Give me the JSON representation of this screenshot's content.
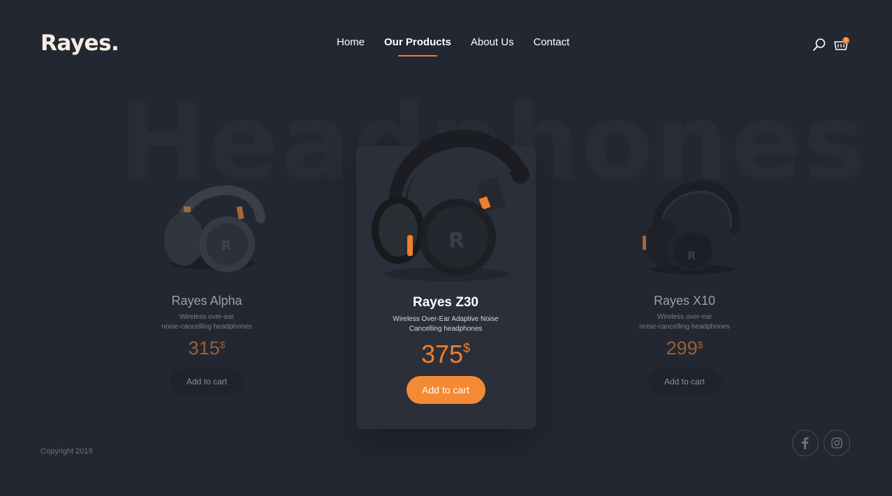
{
  "brand": {
    "logo": "Rayes."
  },
  "nav": {
    "items": [
      {
        "label": "Home"
      },
      {
        "label": "Our Products",
        "active": true
      },
      {
        "label": "About Us"
      },
      {
        "label": "Contact"
      }
    ]
  },
  "header": {
    "search_icon": "search-icon",
    "cart_icon": "cart-icon",
    "cart_count": "3"
  },
  "hero": {
    "watermark": "Headphones"
  },
  "products": [
    {
      "name": "Rayes Alpha",
      "desc_line1": "Wireless over-ear",
      "desc_line2": "noise-cancelling headphones",
      "price": "315",
      "currency": "$",
      "button": "Add to cart"
    },
    {
      "name": "Rayes Z30",
      "desc_line1": "Wireless Over-Ear Adaptive Noise",
      "desc_line2": "Cancelling headphones",
      "price": "375",
      "currency": "$",
      "button": "Add to cart",
      "featured": true
    },
    {
      "name": "Rayes X10",
      "desc_line1": "Wireless over-ear",
      "desc_line2": "noise-cancelling headphones",
      "price": "299",
      "currency": "$",
      "button": "Add to cart"
    }
  ],
  "footer": {
    "copyright": "Copyright 2019",
    "social": [
      "facebook-icon",
      "instagram-icon"
    ]
  },
  "colors": {
    "accent": "#f07f2c",
    "background": "#232731",
    "card": "#2a2f3a"
  }
}
